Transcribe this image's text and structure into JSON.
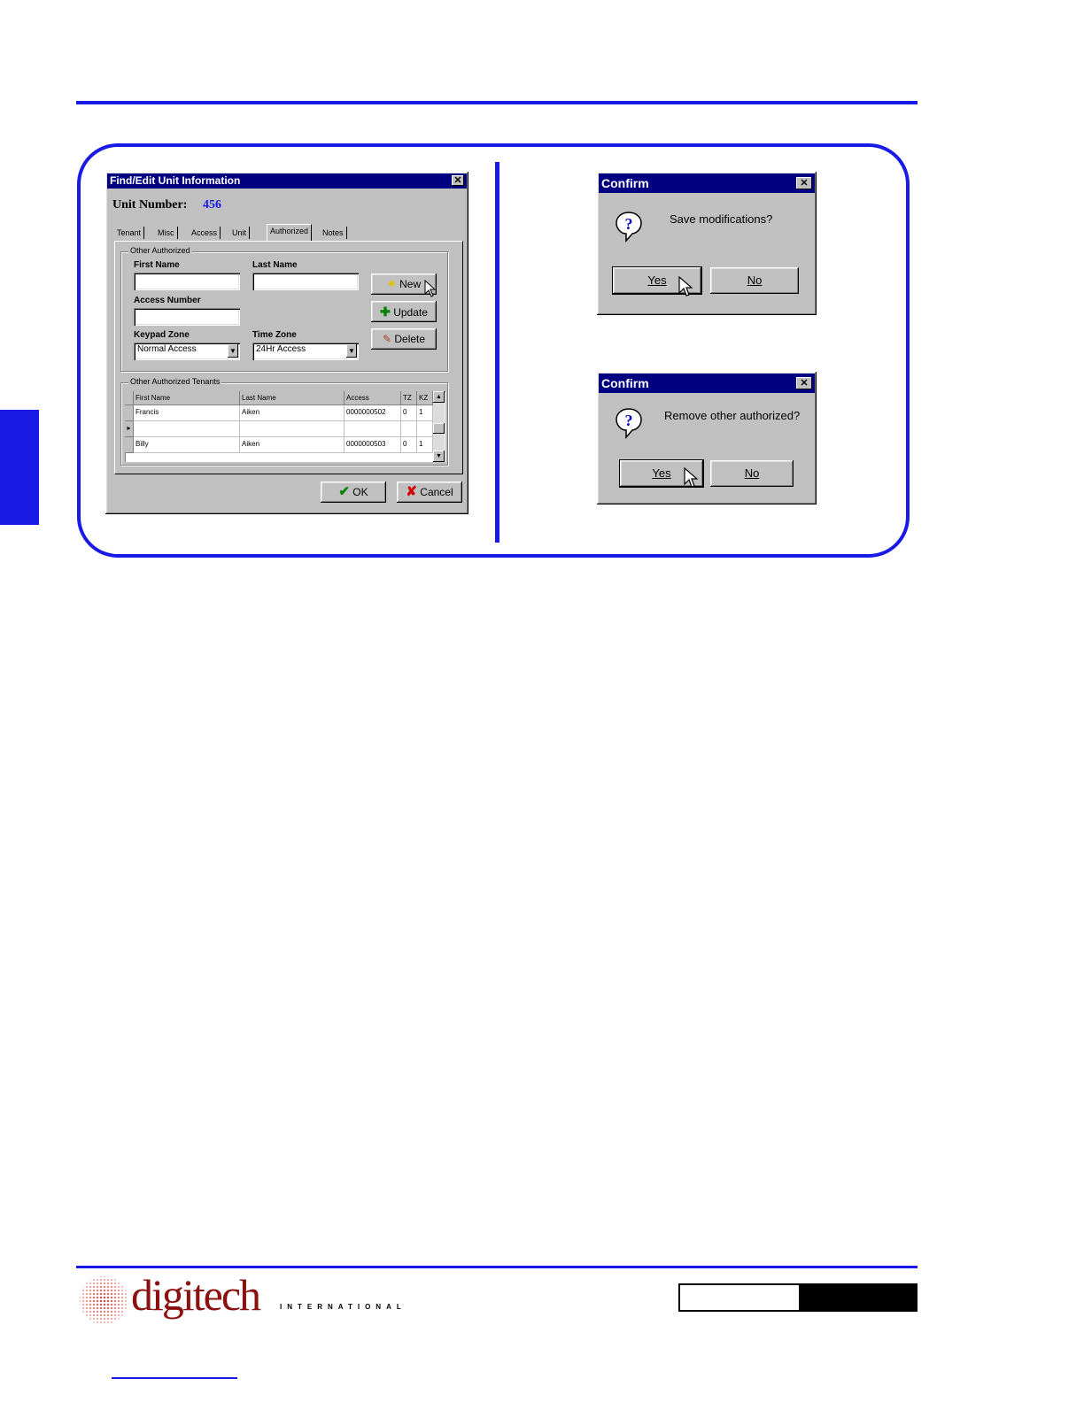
{
  "main_dialog": {
    "title": "Find/Edit Unit Information",
    "unit_number_label": "Unit Number:",
    "unit_number_value": "456",
    "tabs": [
      "Tenant",
      "Misc",
      "Access",
      "Unit",
      "Authorized",
      "Notes"
    ],
    "active_tab": "Authorized",
    "group_other_authorized": "Other Authorized",
    "first_name_label": "First Name",
    "last_name_label": "Last Name",
    "access_number_label": "Access Number",
    "keypad_zone_label": "Keypad Zone",
    "keypad_zone_value": "Normal Access",
    "time_zone_label": "Time Zone",
    "time_zone_value": "24Hr Access",
    "new_button": "New",
    "update_button": "Update",
    "delete_button": "Delete",
    "group_other_authorized_tenants": "Other Authorized Tenants",
    "grid_headers": [
      "First Name",
      "Last Name",
      "Access",
      "TZ",
      "KZ"
    ],
    "grid_rows": [
      [
        "Francis",
        "Aiken",
        "0000000502",
        "0",
        "1"
      ],
      [
        "",
        "",
        "",
        "",
        ""
      ],
      [
        "Billy",
        "Aiken",
        "0000000503",
        "0",
        "1"
      ]
    ],
    "ok_button": "OK",
    "cancel_button": "Cancel"
  },
  "confirm_save": {
    "title": "Confirm",
    "message": "Save modifications?",
    "yes_button": "Yes",
    "no_button": "No"
  },
  "confirm_remove": {
    "title": "Confirm",
    "message": "Remove other authorized?",
    "yes_button": "Yes",
    "no_button": "No"
  },
  "footer": {
    "logo_main": "digitech",
    "logo_sub": "INTERNATIONAL"
  },
  "colors": {
    "accent_blue": "#1a1ae6",
    "title_bar": "#000080",
    "dialog_face": "#c0c0c0"
  }
}
